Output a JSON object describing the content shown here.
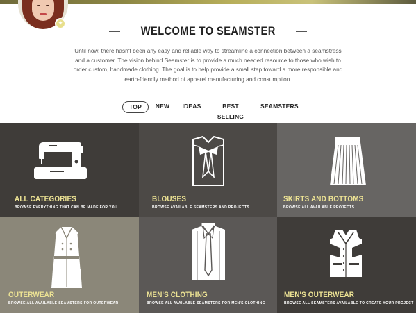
{
  "page": {
    "title": "WELCOME TO SEAMSTER",
    "intro": "Until now, there hasn't been any easy and reliable way to streamline a connection between a seamstress and a customer. The vision behind Seamster is to provide a much needed resource to those who wish to order custom, handmade clothing. The goal is to help provide a small step toward a more responsible and earth-friendly method of apparel manufacturing and consumption."
  },
  "tabs": [
    {
      "label": "TOP",
      "active": true
    },
    {
      "label": "NEW",
      "active": false
    },
    {
      "label": "IDEAS",
      "active": false
    },
    {
      "label": "BEST SELLING",
      "active": false
    },
    {
      "label": "SEAMSTERS",
      "active": false
    }
  ],
  "categories": [
    {
      "title": "ALL CATEGORIES",
      "subtitle": "BROWSE EVERYTHING THAT CAN BE MADE FOR YOU",
      "icon": "sewing-machine-icon"
    },
    {
      "title": "BLOUSES",
      "subtitle": "BROWSE AVAILABLE SEAMSTERS AND PROJECTS",
      "icon": "blouse-icon"
    },
    {
      "title": "SKIRTS AND BOTTOMS",
      "subtitle": "BROWSE ALL AVAILABLE PROJECTS",
      "icon": "skirt-icon"
    },
    {
      "title": "OUTERWEAR",
      "subtitle": "BROWSE ALL AVAILABLE SEAMSTERS FOR OUTERWEAR",
      "icon": "trench-coat-icon"
    },
    {
      "title": "MEN'S CLOTHING",
      "subtitle": "BROWSE ALL AVAILABLE SEAMSTERS FOR MEN'S CLOTHING",
      "icon": "shirt-tie-icon"
    },
    {
      "title": "MEN'S OUTERWEAR",
      "subtitle": "BROWSE ALL SEAMSTERS AVAILABLE TO CREATE YOUR PROJECT",
      "icon": "vest-icon"
    }
  ],
  "colors": {
    "tile_dark": "#3f3c39",
    "tile_mid": "#5b5856",
    "tile_light": "#7a7876",
    "tile_taupe": "#8b8779",
    "accent_yellow": "#ede394"
  }
}
